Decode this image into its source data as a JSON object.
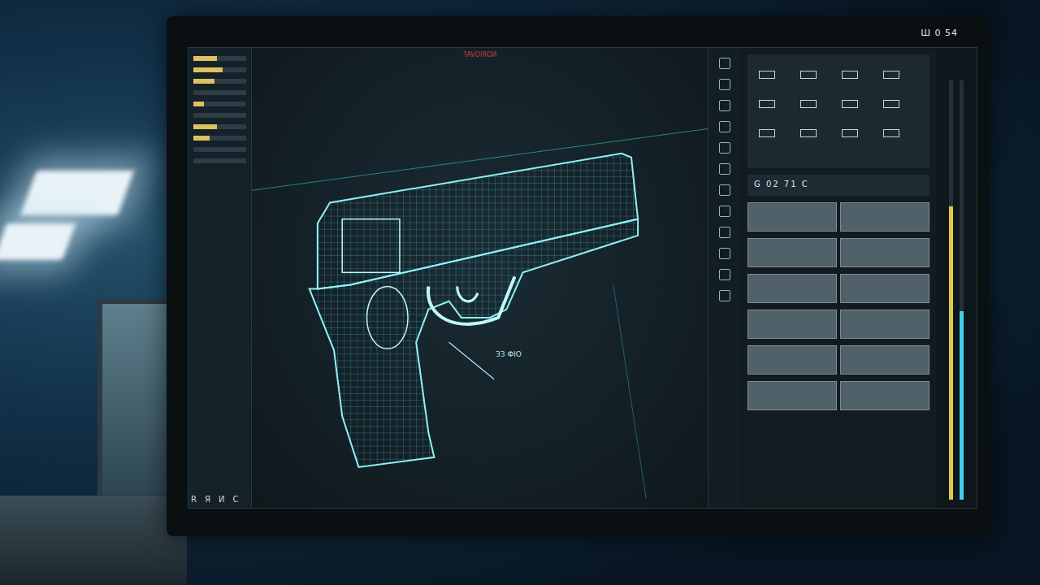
{
  "clock": "Ш 0 54",
  "viewport": {
    "title": "ꟻAVOIЯOИ",
    "dimension": "ЗЗ ФІО"
  },
  "left_panel": {
    "sliders": [
      {
        "level": 0.45
      },
      {
        "level": 0.55
      },
      {
        "level": 0.4
      },
      {
        "level": 0.0
      },
      {
        "level": 0.2
      },
      {
        "level": 0.0
      },
      {
        "level": 0.45
      },
      {
        "level": 0.3
      },
      {
        "level": 0.0
      },
      {
        "level": 0.0
      }
    ]
  },
  "right_panel": {
    "header": "G 02 71 C",
    "rows": 6
  },
  "meters": [
    {
      "level": 0.7,
      "color": "#e0c84a"
    },
    {
      "level": 0.45,
      "color": "#3fd0e6"
    }
  ],
  "toolbar": [
    "R",
    "Я",
    "И",
    "C"
  ]
}
